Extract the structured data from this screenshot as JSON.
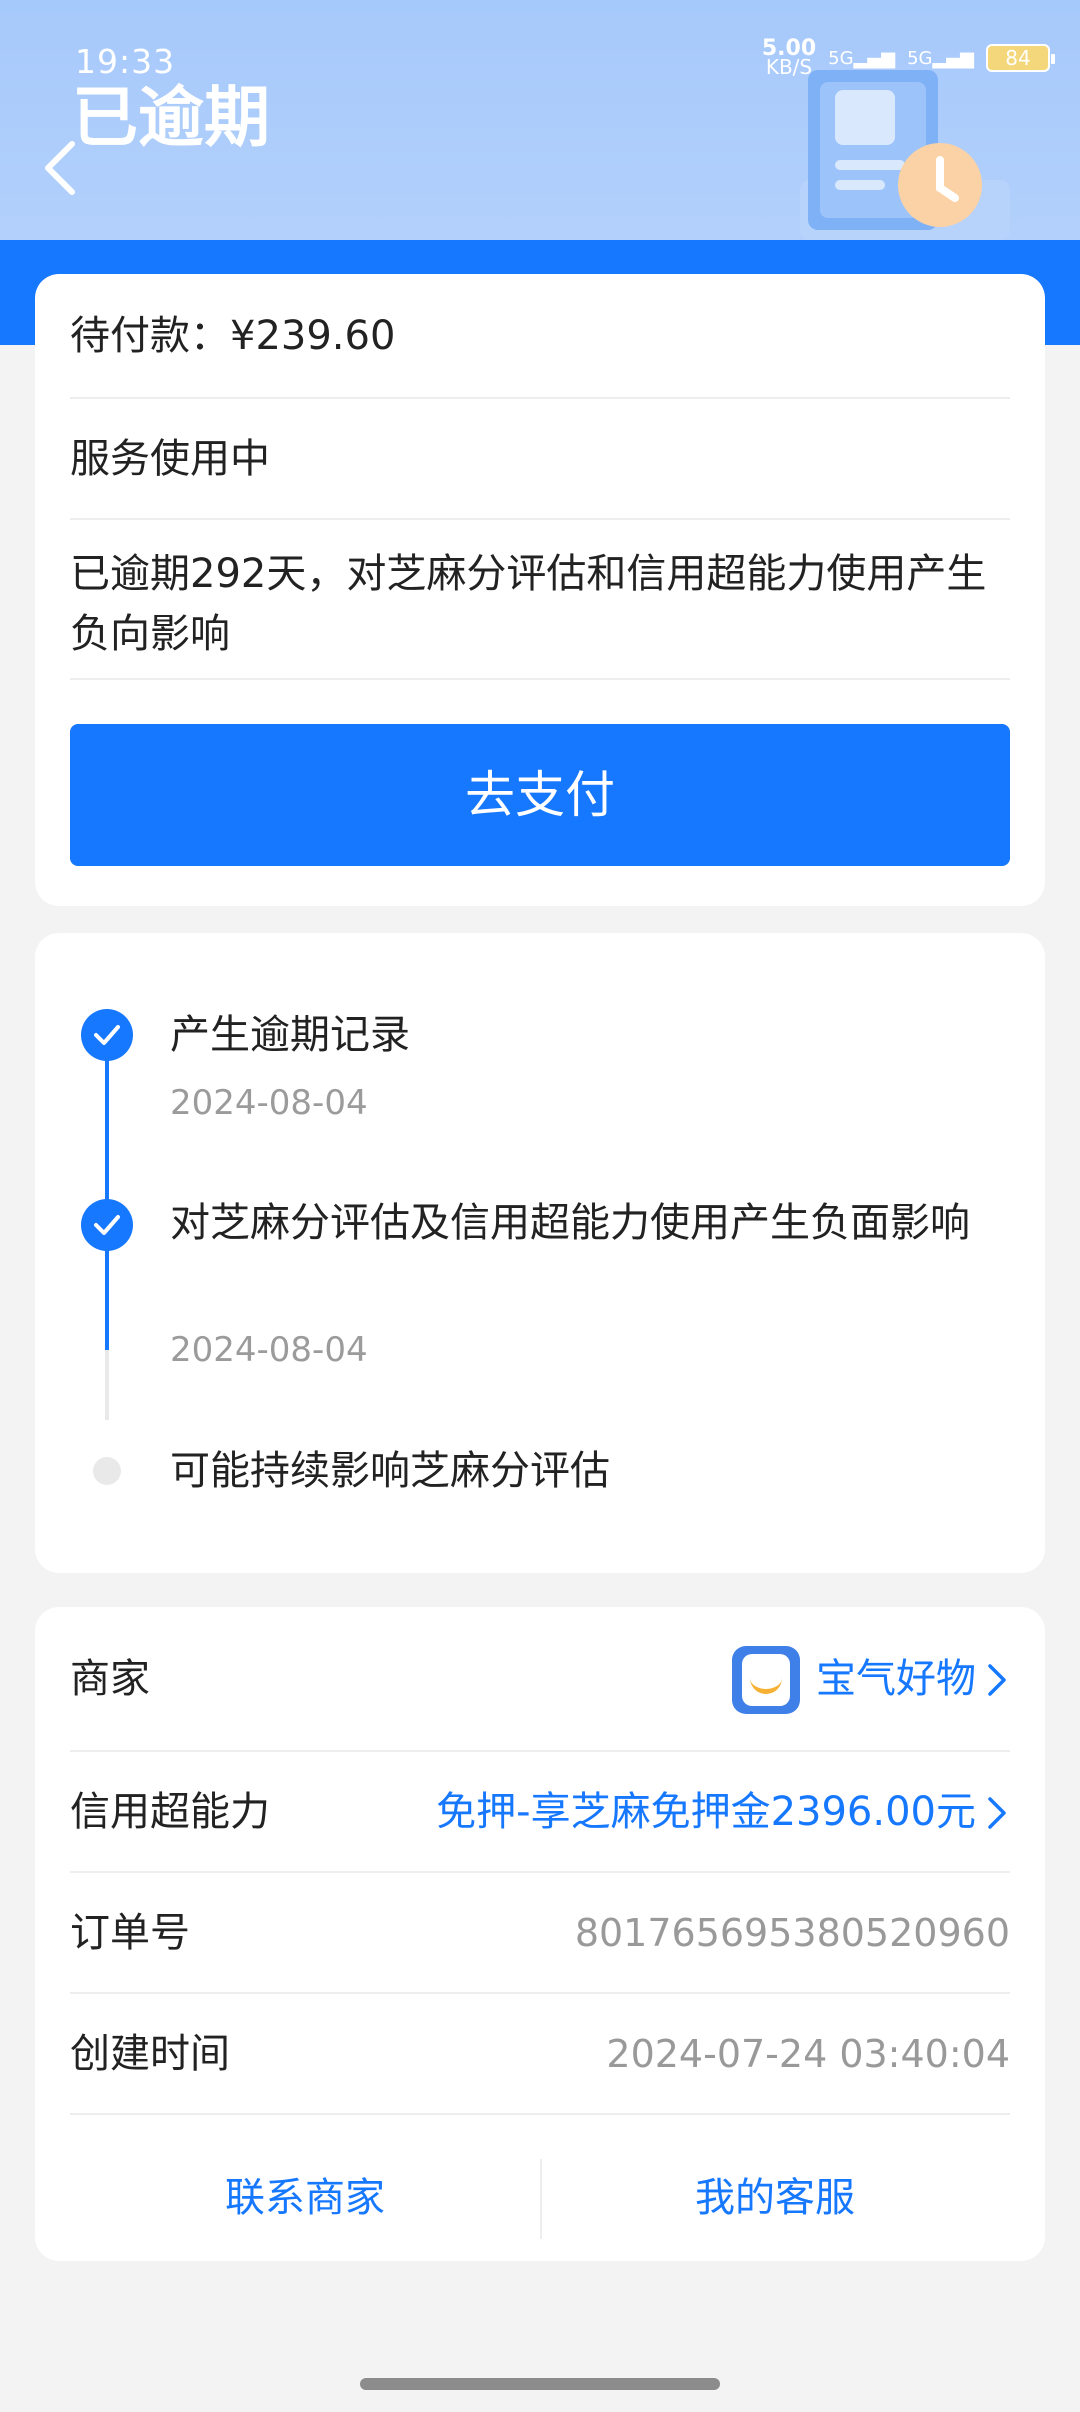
{
  "status_bar": {
    "time": "19:33",
    "net_speed_value": "5.00",
    "net_speed_unit": "KB/S",
    "signal_1": "5G",
    "signal_2": "5G",
    "battery": "84"
  },
  "header": {
    "title": "已逾期",
    "back_icon": "chevron-left-icon"
  },
  "payment_card": {
    "amount_due": "待付款：¥239.60",
    "service_status": "服务使用中",
    "overdue_notice": "已逾期292天，对芝麻分评估和信用超能力使用产生负向影响",
    "pay_button": "去支付"
  },
  "timeline": [
    {
      "title": "产生逾期记录",
      "date": "2024-08-04",
      "done": true
    },
    {
      "title": "对芝麻分评估及信用超能力使用产生负面影响",
      "date": "2024-08-04",
      "done": true
    },
    {
      "title": "可能持续影响芝麻分评估",
      "date": "",
      "done": false
    }
  ],
  "details": {
    "merchant_label": "商家",
    "merchant_name": "宝气好物",
    "credit_label": "信用超能力",
    "credit_value": "免押-享芝麻免押金2396.00元",
    "order_label": "订单号",
    "order_value": "801765695380520960",
    "created_label": "创建时间",
    "created_value": "2024-07-24 03:40:04"
  },
  "actions": {
    "contact_merchant": "联系商家",
    "my_service": "我的客服"
  },
  "colors": {
    "accent": "#1677ff",
    "header_bg": "#a6c9fb",
    "muted_text": "#999999"
  }
}
